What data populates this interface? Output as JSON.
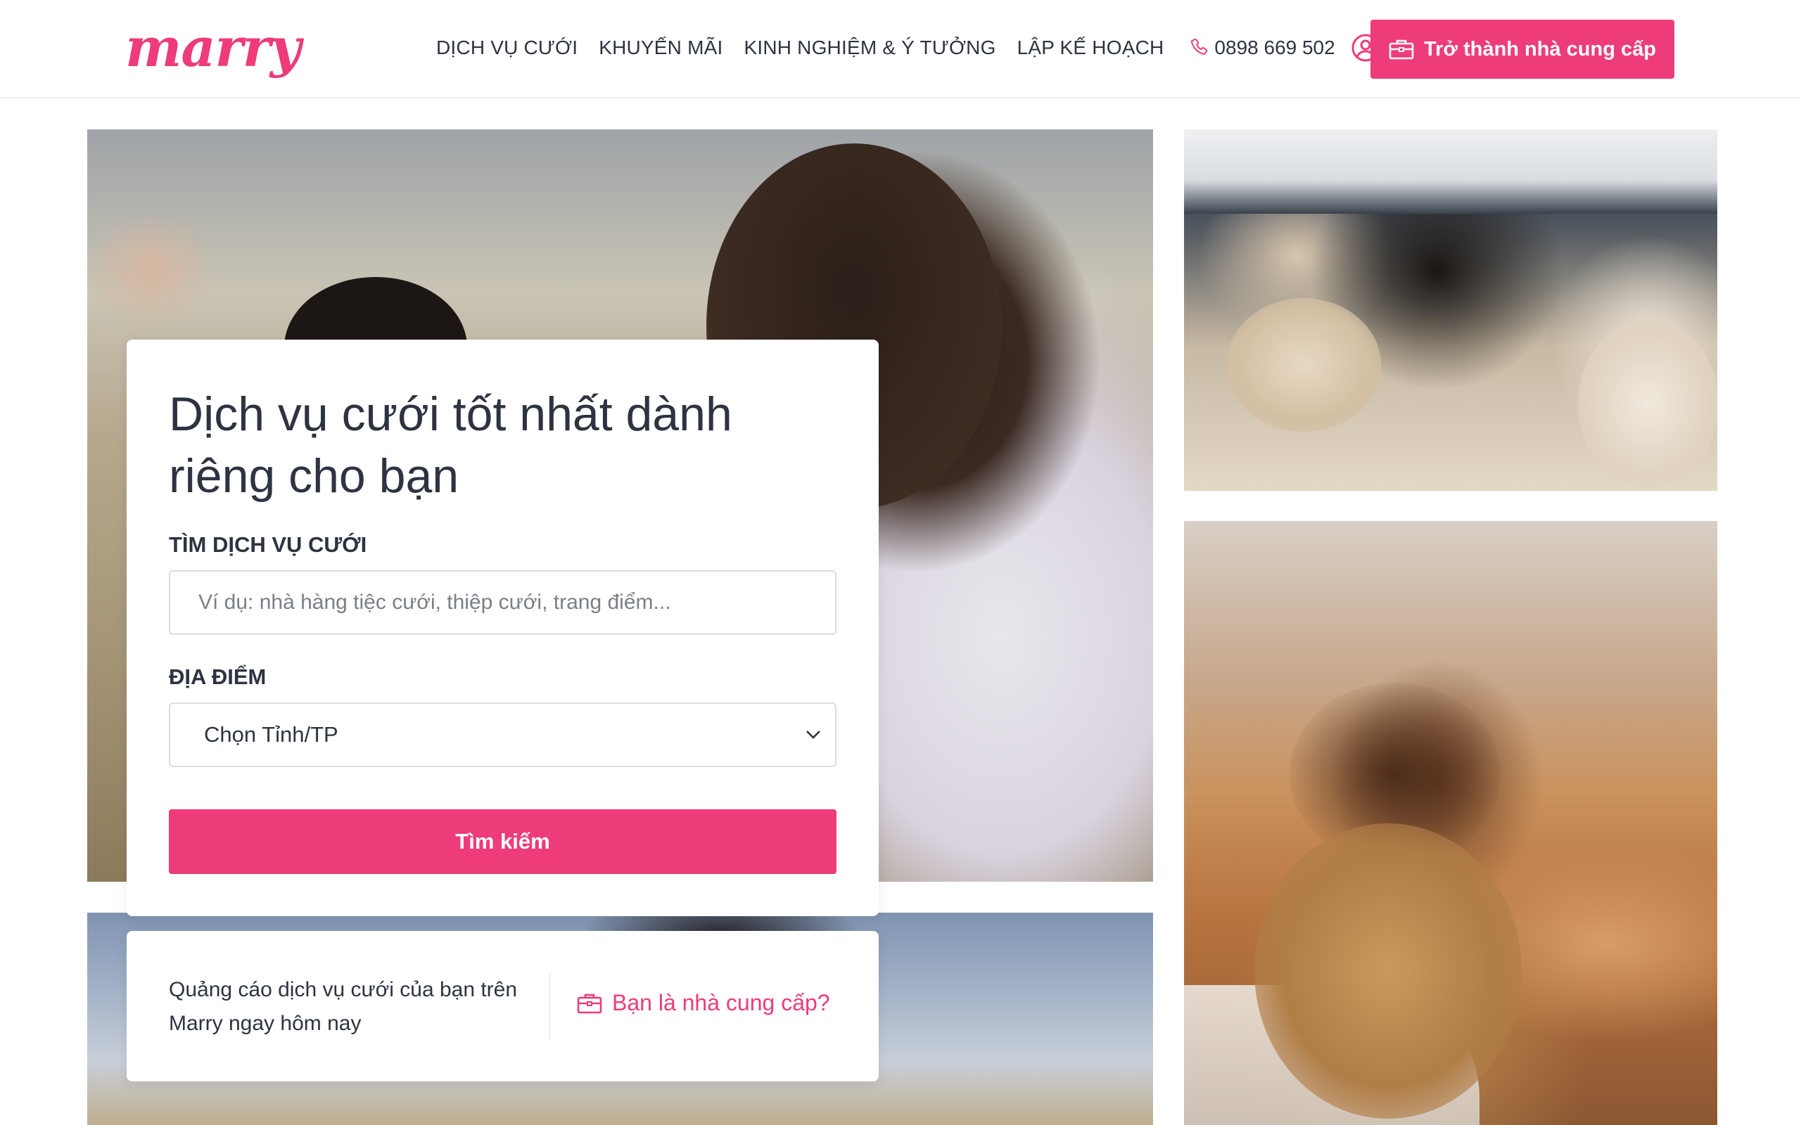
{
  "brand": {
    "logo": "marry",
    "accent_color": "#ee3b7a"
  },
  "nav": {
    "items": [
      {
        "label": "DỊCH VỤ CƯỚI"
      },
      {
        "label": "KHUYẾN MÃI"
      },
      {
        "label": "KINH NGHIỆM & Ý TƯỞNG"
      },
      {
        "label": "LẬP KẾ HOẠCH"
      }
    ],
    "phone": "0898 669 502",
    "cta_label": "Trở thành nhà cung cấp"
  },
  "search": {
    "title": "Dịch vụ cưới tốt nhất dành riêng cho bạn",
    "service_label": "TÌM DỊCH VỤ CƯỚI",
    "service_placeholder": "Ví dụ: nhà hàng tiệc cưới, thiệp cưới, trang điểm...",
    "location_label": "ĐỊA ĐIỂM",
    "location_selected": "Chọn Tỉnh/TP",
    "button_label": "Tìm kiếm"
  },
  "promo": {
    "text": "Quảng cáo dịch vụ cưới của bạn trên Marry ngay hôm nay",
    "link_label": "Bạn là nhà cung cấp?"
  },
  "icons": {
    "phone": "phone-icon",
    "account": "user-circle-icon",
    "briefcase": "briefcase-icon",
    "chevron": "chevron-down-icon"
  }
}
